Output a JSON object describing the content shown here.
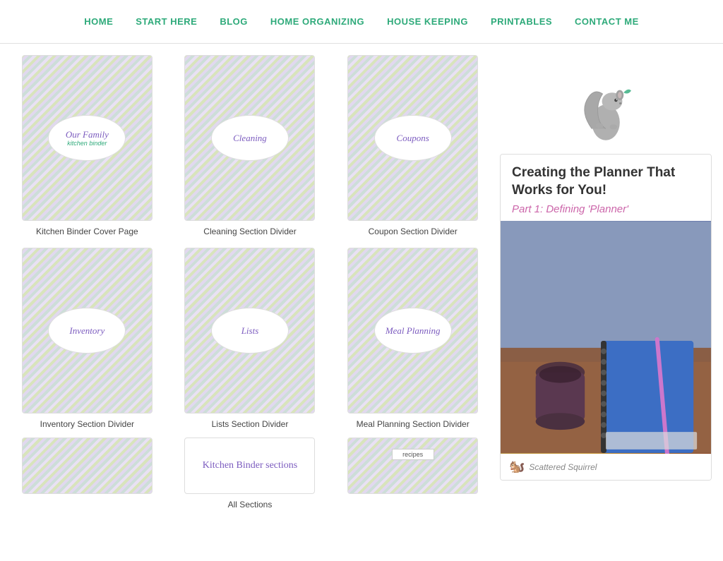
{
  "nav": {
    "items": [
      {
        "label": "HOME",
        "href": "#"
      },
      {
        "label": "START HERE",
        "href": "#"
      },
      {
        "label": "BLOG",
        "href": "#"
      },
      {
        "label": "HOME ORGANIZING",
        "href": "#"
      },
      {
        "label": "HOUSE KEEPING",
        "href": "#"
      },
      {
        "label": "PRINTABLES",
        "href": "#"
      },
      {
        "label": "CONTACT ME",
        "href": "#"
      }
    ]
  },
  "binder_cards": [
    {
      "id": "kitchen-binder",
      "main_label": "Our Family",
      "sub_label": "kitchen binder",
      "title": "Kitchen Binder Cover Page"
    },
    {
      "id": "cleaning",
      "main_label": "Cleaning",
      "sub_label": "",
      "title": "Cleaning Section Divider"
    },
    {
      "id": "coupons",
      "main_label": "Coupons",
      "sub_label": "",
      "title": "Coupon Section Divider"
    },
    {
      "id": "inventory",
      "main_label": "Inventory",
      "sub_label": "",
      "title": "Inventory Section Divider"
    },
    {
      "id": "lists",
      "main_label": "Lists",
      "sub_label": "",
      "title": "Lists Section Divider"
    },
    {
      "id": "meal-planning",
      "main_label": "Meal Planning",
      "sub_label": "",
      "title": "Meal Planning Section Divider"
    }
  ],
  "bottom_row": {
    "sections_label_prefix": "Kitchen Binder ",
    "sections_label_suffix": "sections",
    "all_sections": "All Sections"
  },
  "sidebar": {
    "promo": {
      "title": "Creating the Planner That Works for You!",
      "subtitle": "Part 1: Defining 'Planner'",
      "footer": "Scattered Squirrel"
    }
  }
}
